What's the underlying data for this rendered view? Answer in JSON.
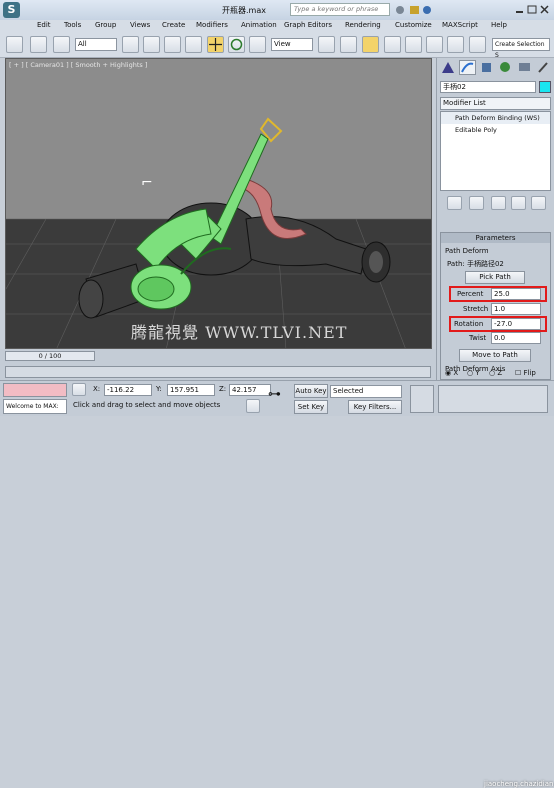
{
  "titlebar": {
    "doc_title": "开瓶器.max",
    "search_placeholder": "Type a keyword or phrase",
    "menus": [
      "Edit",
      "Tools",
      "Group",
      "Views",
      "Create",
      "Modifiers",
      "Animation",
      "Graph Editors",
      "Rendering",
      "Customize",
      "MAXScript",
      "Help"
    ]
  },
  "toolbar": {
    "selection_filter": "All",
    "ref_coord": "View",
    "named_selection": "Create Selection S"
  },
  "viewport": {
    "label": "[ + ] [ Camera01 ] [ Smooth + Highlights ]",
    "watermark": "腾龍視覺 WWW.TLVI.NET"
  },
  "panel": {
    "object_name": "手柄02",
    "object_color": "#19e6f0",
    "modifier_list": "Modifier List",
    "stack": [
      "Path Deform Binding (WS)",
      "Editable Poly"
    ],
    "rollout_title": "Parameters",
    "path_deform_label": "Path Deform",
    "path_label": "Path: 手柄路径02",
    "pick_path": "Pick Path",
    "percent_label": "Percent",
    "percent_value": "25.0",
    "stretch_label": "Stretch",
    "stretch_value": "1.0",
    "rotation_label": "Rotation",
    "rotation_value": "-27.0",
    "twist_label": "Twist",
    "twist_value": "0.0",
    "move_to_path": "Move to Path",
    "axis_label": "Path Deform Axis",
    "axis_x": "X",
    "axis_y": "Y",
    "axis_z": "Z",
    "flip": "Flip"
  },
  "timeline": {
    "frame": "0 / 100"
  },
  "status": {
    "welcome": "Welcome to MAX:",
    "prompt": "Click and drag to select and move objects",
    "x_label": "X:",
    "x_value": "-116.22",
    "y_label": "Y:",
    "y_value": "157.951",
    "z_label": "Z:",
    "z_value": "42.157",
    "auto_key": "Auto Key",
    "set_key": "Set Key",
    "key_mode": "Selected",
    "key_filters": "Key Filters...",
    "site_watermark": "jiaocheng.chazidian.com"
  }
}
